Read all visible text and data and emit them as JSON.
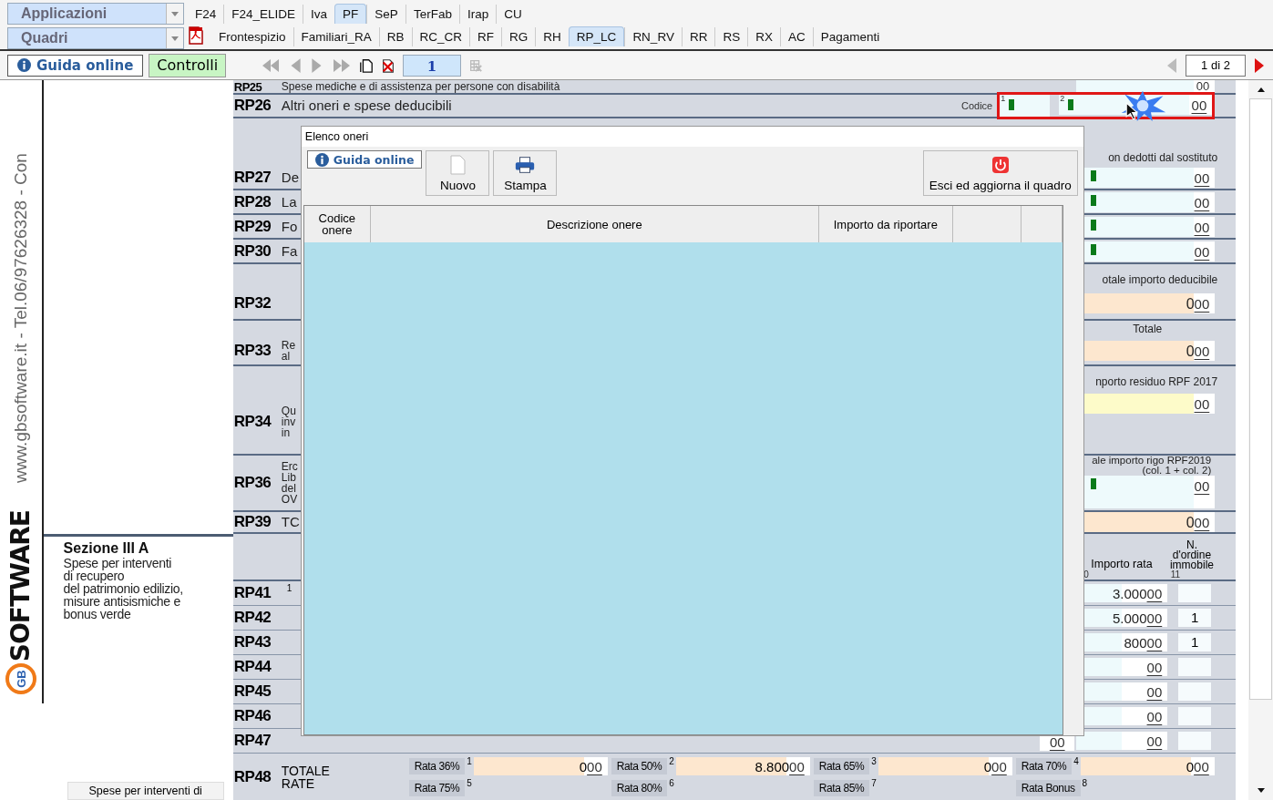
{
  "apps_selector": {
    "value": "Applicazioni"
  },
  "quadri_selector": {
    "value": "Quadri"
  },
  "app_tabs": [
    {
      "label": "F24",
      "selected": false
    },
    {
      "label": "F24_ELIDE",
      "selected": false
    },
    {
      "label": "Iva",
      "selected": false
    },
    {
      "label": "PF",
      "selected": true
    },
    {
      "label": "SeP",
      "selected": false
    },
    {
      "label": "TerFab",
      "selected": false
    },
    {
      "label": "Irap",
      "selected": false
    },
    {
      "label": "CU",
      "selected": false
    }
  ],
  "quadri_tabs": [
    {
      "label": "Frontespizio",
      "selected": false
    },
    {
      "label": "Familiari_RA",
      "selected": false
    },
    {
      "label": "RB",
      "selected": false
    },
    {
      "label": "RC_CR",
      "selected": false
    },
    {
      "label": "RF",
      "selected": false
    },
    {
      "label": "RG",
      "selected": false
    },
    {
      "label": "RH",
      "selected": false
    },
    {
      "label": "RP_LC",
      "selected": true
    },
    {
      "label": "RN_RV",
      "selected": false
    },
    {
      "label": "RR",
      "selected": false
    },
    {
      "label": "RS",
      "selected": false
    },
    {
      "label": "RX",
      "selected": false
    },
    {
      "label": "AC",
      "selected": false
    },
    {
      "label": "Pagamenti",
      "selected": false
    }
  ],
  "toolbar": {
    "help": "Guida online",
    "checks": "Controlli",
    "page": "1",
    "page_count": "1 di 2"
  },
  "side_text": "www.gbsoftware.it - Tel.06/97626328 - Con",
  "logo": {
    "mark": "GB",
    "text": "SOFTWARE"
  },
  "section": {
    "title": "Sezione III A",
    "lines": [
      "Spese per interventi",
      "di recupero",
      "del patrimonio edilizio,",
      "misure antisismiche e",
      "bonus verde"
    ],
    "footer_button": "Spese per interventi di"
  },
  "form": {
    "rows": [
      {
        "kind": "line",
        "code": "RP25",
        "desc": [
          "Spese mediche e di assistenza per persone con disabilità"
        ],
        "field": {
          "color": "#eefafc",
          "dec": "00",
          "marked": false
        }
      },
      {
        "kind": "codice",
        "code": "RP26",
        "desc": [
          "Altri oneri e spese deducibili"
        ],
        "codice_label": "Codice",
        "sub1": "1",
        "sub2": "2",
        "highlighted": true,
        "field": {
          "color": "#eefafc",
          "dec": "00",
          "marked": true
        }
      },
      {
        "kind": "header",
        "text": [
          "on dedotti dal sostituto"
        ]
      },
      {
        "kind": "line",
        "code": "RP27",
        "desc": [
          "De"
        ],
        "field": {
          "color": "#eefafc",
          "dec": "00",
          "marked": true
        }
      },
      {
        "kind": "line",
        "code": "RP28",
        "desc": [
          "La"
        ],
        "field": {
          "color": "#eefafc",
          "dec": "00",
          "marked": true
        }
      },
      {
        "kind": "line",
        "code": "RP29",
        "desc": [
          "Fo"
        ],
        "field": {
          "color": "#eefafc",
          "dec": "00",
          "marked": true
        }
      },
      {
        "kind": "line",
        "code": "RP30",
        "desc": [
          "Fa"
        ],
        "field": {
          "color": "#eefafc",
          "dec": "00",
          "marked": true
        }
      },
      {
        "kind": "header",
        "text": [
          "otale importo deducibile"
        ]
      },
      {
        "kind": "line",
        "code": "RP32",
        "field": {
          "color": "#fde7cf",
          "int": "0",
          "dec": "00",
          "marked": false
        }
      },
      {
        "kind": "header",
        "text": [
          "Totale"
        ]
      },
      {
        "kind": "line",
        "code": "RP33",
        "desc": [
          "Re",
          "al"
        ],
        "field": {
          "color": "#fde7cf",
          "int": "0",
          "dec": "00",
          "marked": false
        }
      },
      {
        "kind": "header",
        "text": [
          "nporto residuo RPF 2017"
        ]
      },
      {
        "kind": "line",
        "code": "RP34",
        "desc": [
          "Qu",
          "inv",
          "in"
        ],
        "field": {
          "color": "#fdfbc9",
          "dec": "00",
          "marked": false
        }
      },
      {
        "kind": "line",
        "code": "RP36",
        "desc": [
          "Erc",
          "Lib",
          "del",
          "OV"
        ],
        "head": [
          "ale importo rigo RPF2019",
          "(col. 1 + col. 2)"
        ],
        "field": {
          "color": "#eefafc",
          "dec": "00",
          "marked": true
        }
      },
      {
        "kind": "line",
        "code": "RP39",
        "desc": [
          "TC"
        ],
        "field": {
          "color": "#fde7cf",
          "int": "0",
          "dec": "00",
          "marked": false
        }
      },
      {
        "kind": "section",
        "amount_label": "Importo rata",
        "amount_no": "0",
        "order_label": "N. d'ordine immobile",
        "order_no": "11"
      },
      {
        "kind": "rata",
        "code": "RP41",
        "sup": "1",
        "amount": {
          "int": "3.000",
          "dec": "00"
        }
      },
      {
        "kind": "rata",
        "code": "RP42",
        "amount": {
          "int": "5.000",
          "dec": "00"
        },
        "order": "1"
      },
      {
        "kind": "rata",
        "code": "RP43",
        "amount": {
          "int": "800",
          "dec": "00"
        },
        "order": "1"
      },
      {
        "kind": "rata",
        "code": "RP44",
        "amount": {
          "dec": "00"
        }
      },
      {
        "kind": "rata",
        "code": "RP45",
        "amount": {
          "dec": "00"
        }
      },
      {
        "kind": "rata",
        "code": "RP46",
        "amount": {
          "dec": "00"
        }
      },
      {
        "kind": "rata",
        "code": "RP47",
        "extra": "00",
        "amount": {
          "dec": "00"
        }
      },
      {
        "kind": "totals",
        "code": "RP48",
        "title": [
          "TOTALE",
          "RATE"
        ],
        "cells": [
          {
            "label": "Rata 36%",
            "no": "1",
            "int": "0",
            "dec": "00"
          },
          {
            "label": "Rata 50%",
            "no": "2",
            "int": "8.800",
            "dec": "00"
          },
          {
            "label": "Rata 65%",
            "no": "3",
            "int": "0",
            "dec": "00"
          },
          {
            "label": "Rata 70%",
            "no": "4",
            "int": "0",
            "dec": "00"
          },
          {
            "label": "Rata 75%",
            "no": "5"
          },
          {
            "label": "Rata 80%",
            "no": "6"
          },
          {
            "label": "Rata 85%",
            "no": "7"
          },
          {
            "label": "Rata Bonus",
            "no": "8"
          }
        ]
      }
    ]
  },
  "dialog": {
    "title": "Elenco oneri",
    "help": "Guida online",
    "buttons": [
      {
        "kind": "new",
        "label": "Nuovo"
      },
      {
        "kind": "print",
        "label": "Stampa"
      }
    ],
    "exit": "Esci ed aggiorna il quadro",
    "columns": [
      "Codice onere",
      "Descrizione onere",
      "Importo da riportare"
    ]
  }
}
